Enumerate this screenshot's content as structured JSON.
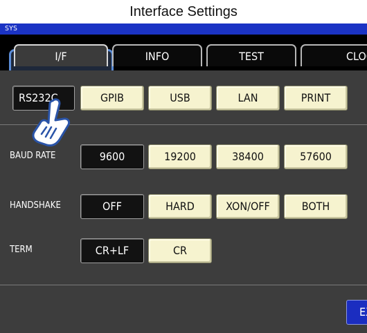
{
  "window": {
    "title": "Interface Settings",
    "sys_label": "SYS"
  },
  "tabs": [
    {
      "label": "I/F",
      "active": true
    },
    {
      "label": "INFO",
      "active": false
    },
    {
      "label": "TEST",
      "active": false
    },
    {
      "label": "CLOCK",
      "active": false
    }
  ],
  "interface": {
    "options": [
      "RS232C",
      "GPIB",
      "USB",
      "LAN",
      "PRINT"
    ],
    "selected": "RS232C"
  },
  "baud_rate": {
    "label": "BAUD RATE",
    "options": [
      "9600",
      "19200",
      "38400",
      "57600"
    ],
    "selected": "9600"
  },
  "handshake": {
    "label": "HANDSHAKE",
    "options": [
      "OFF",
      "HARD",
      "XON/OFF",
      "BOTH"
    ],
    "selected": "OFF"
  },
  "term": {
    "label": "TERM",
    "options": [
      "CR+LF",
      "CR"
    ],
    "selected": "CR+LF"
  },
  "exit_button": {
    "label": "EXIT"
  },
  "colors": {
    "system_bar": "#1b33c4",
    "button_off": "#f6f3cf",
    "button_on": "#121212",
    "panel": "#3d3d3d",
    "highlight": "#5b8cd6"
  },
  "icons": {
    "pointer": "hand-pointer-icon"
  }
}
